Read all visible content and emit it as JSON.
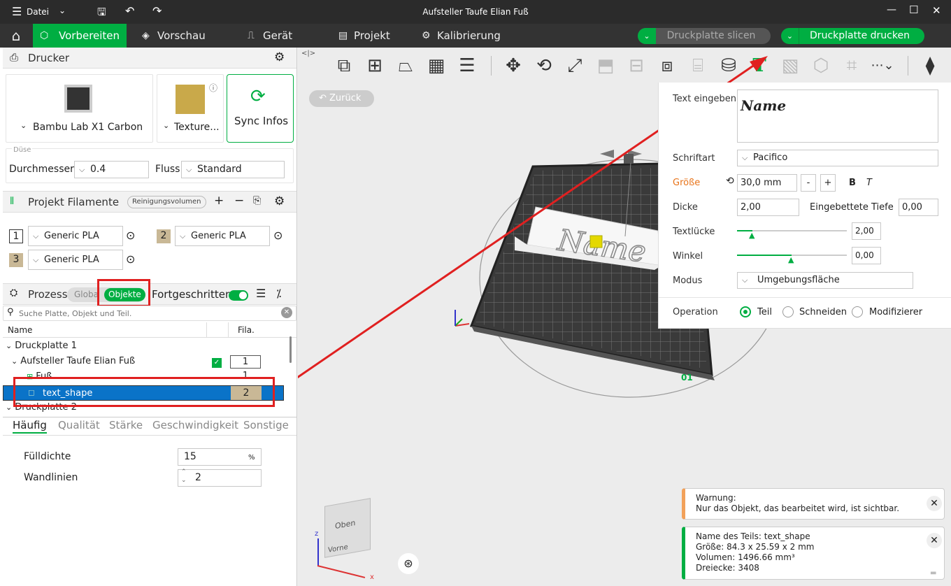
{
  "titlebar": {
    "menu_label": "Datei",
    "title": "Aufsteller Taufe Elian Fuß"
  },
  "tabs": {
    "prepare": "Vorbereiten",
    "preview": "Vorschau",
    "device": "Gerät",
    "project": "Projekt",
    "calibration": "Kalibrierung"
  },
  "actions": {
    "slice": "Druckplatte slicen",
    "print": "Druckplatte drucken"
  },
  "printer": {
    "header": "Drucker",
    "model": "Bambu Lab X1 Carbon",
    "plate": "Texture...",
    "sync": "Sync Infos",
    "nozzle_group": "Düse",
    "diameter_label": "Durchmesser",
    "diameter_value": "0.4",
    "flow_label": "Fluss",
    "flow_value": "Standard"
  },
  "filaments": {
    "header": "Projekt Filamente",
    "purge_button": "Reinigungsvolumen",
    "items": [
      {
        "num": "1",
        "name": "Generic PLA"
      },
      {
        "num": "2",
        "name": "Generic PLA"
      },
      {
        "num": "3",
        "name": "Generic PLA"
      }
    ]
  },
  "process": {
    "header": "Prozess",
    "global": "Globa",
    "objects": "Objekte",
    "advanced": "Fortgeschritten",
    "search_placeholder": "Suche Platte, Objekt und Teil."
  },
  "tree": {
    "col_name": "Name",
    "col_fila": "Fila.",
    "plate1": "Druckplatte 1",
    "object": "Aufsteller Taufe Elian Fuß",
    "object_fila": "1",
    "part1": "Fuß",
    "part1_fila": "1",
    "part2": "text_shape",
    "part2_fila": "2",
    "plate2": "Druckplatte 2"
  },
  "subtabs": {
    "common": "Häufig",
    "quality": "Qualität",
    "strength": "Stärke",
    "speed": "Geschwindigkeit",
    "other": "Sonstige"
  },
  "settings": {
    "infill_label": "Fülldichte",
    "infill_value": "15",
    "infill_unit": "%",
    "walls_label": "Wandlinien",
    "walls_value": "2"
  },
  "canvas": {
    "back": "Zurück",
    "cube_top": "Oben",
    "cube_front": "Vorne",
    "axis_x": "x",
    "axis_z": "z",
    "preview_text": "Name",
    "plate_no": "01"
  },
  "text_panel": {
    "text_label": "Text eingeben",
    "text_value": "Name",
    "font_label": "Schriftart",
    "font_value": "Pacifico",
    "size_label": "Größe",
    "size_value": "30,0 mm",
    "minus": "-",
    "plus": "+",
    "bold": "B",
    "italic": "T",
    "thickness_label": "Dicke",
    "thickness_value": "2,00",
    "embed_label": "Eingebettete Tiefe",
    "embed_value": "0,00",
    "gap_label": "Textlücke",
    "gap_value": "2,00",
    "angle_label": "Winkel",
    "angle_value": "0,00",
    "mode_label": "Modus",
    "mode_value": "Umgebungsfläche",
    "op_label": "Operation",
    "op_part": "Teil",
    "op_cut": "Schneiden",
    "op_mod": "Modifizierer"
  },
  "notifications": {
    "warning_title": "Warnung:",
    "warning_text": "Nur das Objekt, das bearbeitet wird, ist sichtbar.",
    "info_name": "Name des Teils: text_shape",
    "info_size": "Größe: 84.3 x 25.59 x 2 mm",
    "info_volume": "Volumen: 1496.66 mm³",
    "info_tris": "Dreiecke: 3408"
  },
  "colors": {
    "accent": "#00ae42",
    "highlight": "#e02020",
    "selection": "#0a73c8"
  }
}
